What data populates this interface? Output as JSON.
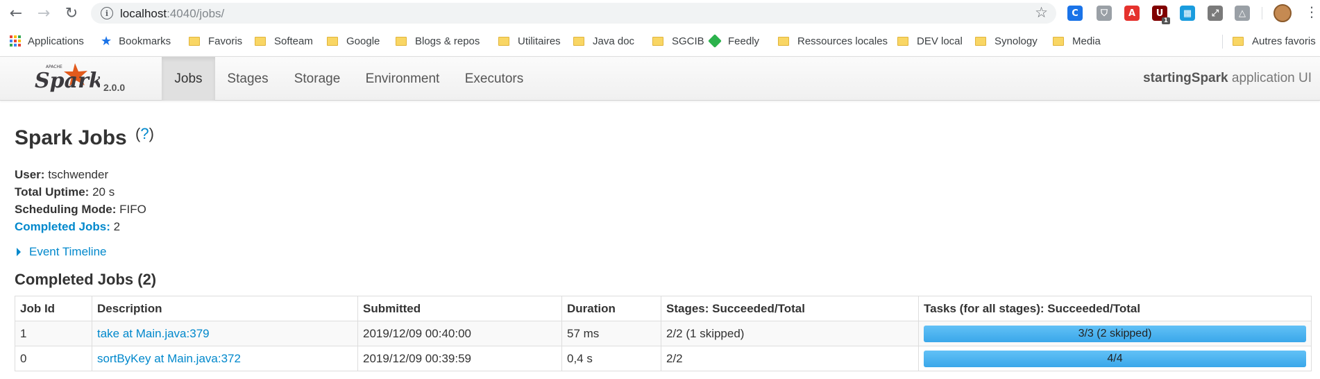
{
  "browser": {
    "url_host": "localhost",
    "url_rest": ":4040/jobs/",
    "extensions": [
      {
        "icon": "refresh-extension-icon",
        "color": "#1a73e8",
        "glyph": "C"
      },
      {
        "icon": "shield-extension-icon",
        "color": "#9aa0a6",
        "glyph": "⛉"
      },
      {
        "icon": "acrobat-extension-icon",
        "color": "#e5322d",
        "glyph": "A"
      },
      {
        "icon": "ublock-extension-icon",
        "color": "#800000",
        "glyph": "U",
        "badge": "1"
      },
      {
        "icon": "window-extension-icon",
        "color": "#1a9cde",
        "glyph": "▦"
      },
      {
        "icon": "screenshot-extension-icon",
        "color": "#7a7a7a",
        "glyph": "⤢"
      },
      {
        "icon": "drive-extension-icon",
        "color": "#9aa0a6",
        "glyph": "△"
      }
    ]
  },
  "bookmarks": {
    "apps": "Applications",
    "items": [
      "Bookmarks",
      "Favoris",
      "Softeam",
      "Google",
      "Blogs & repos",
      "Utilitaires",
      "Java doc",
      "SGCIB",
      "Feedly",
      "Ressources locales",
      "DEV local",
      "Synology",
      "Media"
    ],
    "other": "Autres favoris"
  },
  "spark": {
    "version": "2.0.0",
    "tabs": [
      "Jobs",
      "Stages",
      "Storage",
      "Environment",
      "Executors"
    ],
    "active_tab": "Jobs",
    "app_name": "startingSpark",
    "app_suffix": " application UI"
  },
  "page": {
    "title": "Spark Jobs",
    "help": "?",
    "summary": {
      "user_label": "User:",
      "user_value": " tschwender",
      "uptime_label": "Total Uptime:",
      "uptime_value": " 20 s",
      "mode_label": "Scheduling Mode:",
      "mode_value": " FIFO",
      "completed_label": "Completed Jobs:",
      "completed_value": " 2"
    },
    "event_timeline": "Event Timeline",
    "section_title": "Completed Jobs (2)"
  },
  "table": {
    "headers": [
      "Job Id",
      "Description",
      "Submitted",
      "Duration",
      "Stages: Succeeded/Total",
      "Tasks (for all stages): Succeeded/Total"
    ],
    "rows": [
      {
        "job_id": "1",
        "description": "take at Main.java:379",
        "submitted": "2019/12/09 00:40:00",
        "duration": "57 ms",
        "stages": "2/2 (1 skipped)",
        "tasks_label": "3/3 (2 skipped)",
        "tasks_fraction": 1.0
      },
      {
        "job_id": "0",
        "description": "sortByKey at Main.java:372",
        "submitted": "2019/12/09 00:39:59",
        "duration": "0,4 s",
        "stages": "2/2",
        "tasks_label": "4/4",
        "tasks_fraction": 1.0
      }
    ]
  }
}
